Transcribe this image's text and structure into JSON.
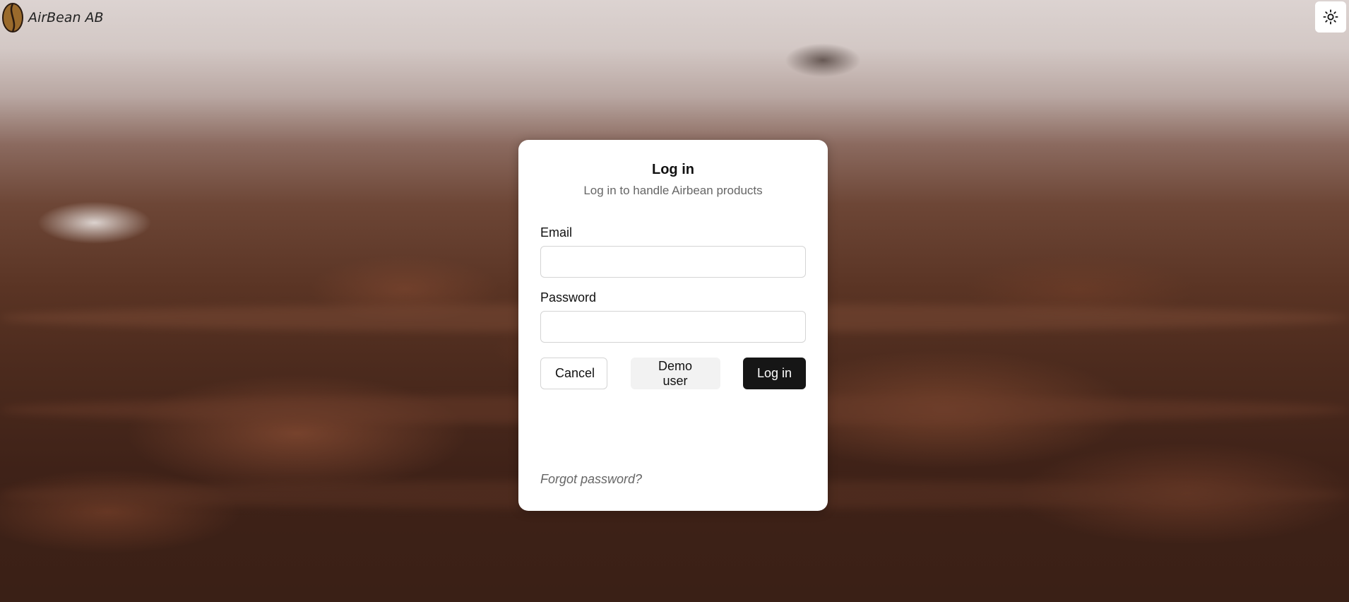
{
  "header": {
    "brand_name": "AirBean AB",
    "logo_icon": "coffee-bean-icon",
    "theme_toggle_icon": "sun-icon"
  },
  "login": {
    "title": "Log in",
    "subtitle": "Log in to handle Airbean products",
    "email_label": "Email",
    "email_value": "",
    "password_label": "Password",
    "password_value": "",
    "cancel_label": "Cancel",
    "demo_label": "Demo user",
    "login_label": "Log in",
    "forgot_label": "Forgot password?"
  },
  "colors": {
    "primary_button": "#161616",
    "background_dark": "#3f2218",
    "card": "#ffffff"
  }
}
